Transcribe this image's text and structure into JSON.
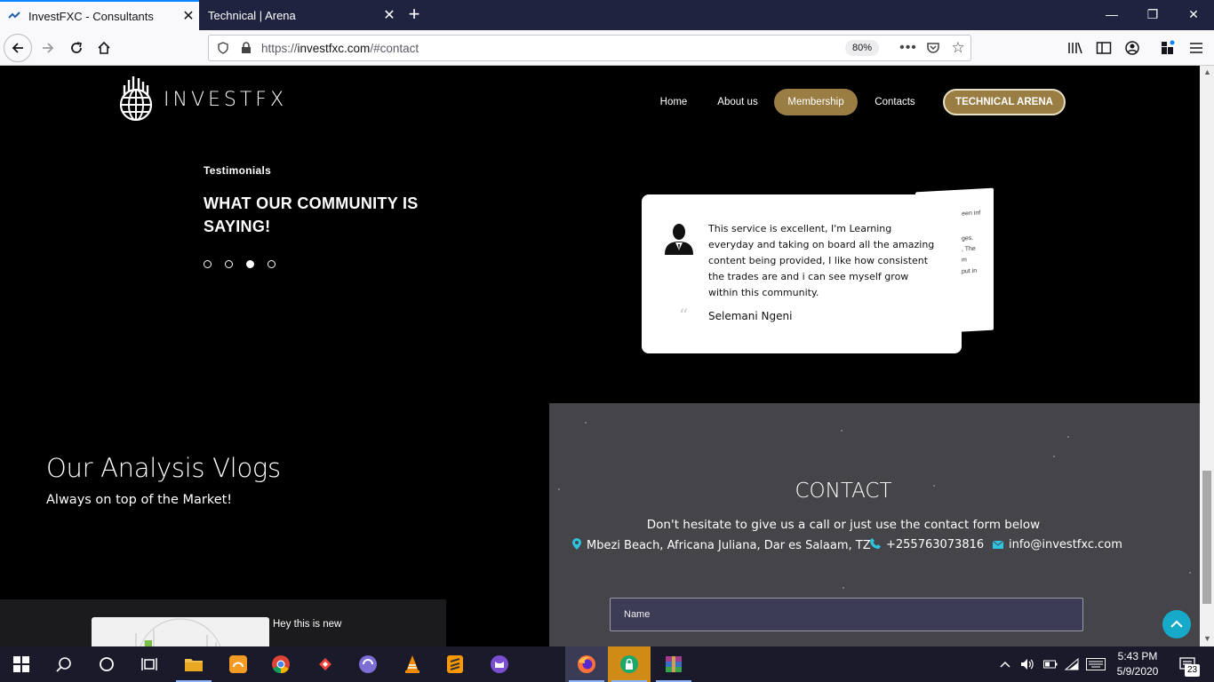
{
  "browser": {
    "tabs": [
      {
        "label": "InvestFXC - Consultants",
        "active": true
      },
      {
        "label": "Technical | Arena",
        "active": false
      }
    ],
    "new_tab": "+",
    "url_scheme": "https://",
    "url_host": "investfxc.com",
    "url_path": "/#contact",
    "zoom": "80%"
  },
  "site": {
    "logo": "INVESTFX",
    "nav": [
      {
        "label": "Home"
      },
      {
        "label": "About us"
      },
      {
        "label": "Membership",
        "highlighted": true
      },
      {
        "label": "Contacts"
      },
      {
        "label": "TECHNICAL ARENA",
        "highlighted": true
      }
    ],
    "accent_color": "#9a7d43"
  },
  "testimonials": {
    "label": "Testimonials",
    "title": "WHAT OUR COMMUNITY IS SAYING!",
    "active_dot": 3,
    "dot_count": 4,
    "quote": "This service is excellent, I'm Learning everyday and taking on board all the amazing content being provided, I like how consistent the trades are and i can see myself grow within this community.",
    "author": "Selemani Ngeni",
    "back_card_fragments": [
      "r been inf",
      "ges.",
      ", The",
      "m",
      "put in"
    ]
  },
  "vlogs": {
    "title": "Our Analysis Vlogs",
    "subtitle": "Always on top of the Market!",
    "item_title": "Hey this is new"
  },
  "contact": {
    "title": "CONTACT",
    "subtitle": "Don't hesitate to give us a call or just use the contact form below",
    "address": "Mbezi Beach, Africana Juliana, Dar es Salaam, TZ",
    "phone": "+255763073816",
    "email": "info@investfxc.com",
    "name_placeholder": "Name",
    "icon_color": "#2ec4e0"
  },
  "taskbar": {
    "time": "5:43 PM",
    "date": "5/9/2020",
    "notifications": "23"
  }
}
